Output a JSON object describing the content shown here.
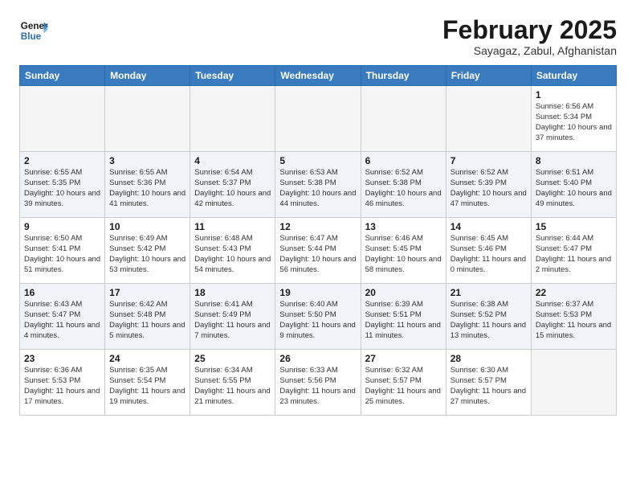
{
  "header": {
    "logo_line1": "General",
    "logo_line2": "Blue",
    "month_title": "February 2025",
    "location": "Sayagaz, Zabul, Afghanistan"
  },
  "weekdays": [
    "Sunday",
    "Monday",
    "Tuesday",
    "Wednesday",
    "Thursday",
    "Friday",
    "Saturday"
  ],
  "weeks": [
    [
      {
        "day": "",
        "info": ""
      },
      {
        "day": "",
        "info": ""
      },
      {
        "day": "",
        "info": ""
      },
      {
        "day": "",
        "info": ""
      },
      {
        "day": "",
        "info": ""
      },
      {
        "day": "",
        "info": ""
      },
      {
        "day": "1",
        "info": "Sunrise: 6:56 AM\nSunset: 5:34 PM\nDaylight: 10 hours and 37 minutes."
      }
    ],
    [
      {
        "day": "2",
        "info": "Sunrise: 6:55 AM\nSunset: 5:35 PM\nDaylight: 10 hours and 39 minutes."
      },
      {
        "day": "3",
        "info": "Sunrise: 6:55 AM\nSunset: 5:36 PM\nDaylight: 10 hours and 41 minutes."
      },
      {
        "day": "4",
        "info": "Sunrise: 6:54 AM\nSunset: 5:37 PM\nDaylight: 10 hours and 42 minutes."
      },
      {
        "day": "5",
        "info": "Sunrise: 6:53 AM\nSunset: 5:38 PM\nDaylight: 10 hours and 44 minutes."
      },
      {
        "day": "6",
        "info": "Sunrise: 6:52 AM\nSunset: 5:38 PM\nDaylight: 10 hours and 46 minutes."
      },
      {
        "day": "7",
        "info": "Sunrise: 6:52 AM\nSunset: 5:39 PM\nDaylight: 10 hours and 47 minutes."
      },
      {
        "day": "8",
        "info": "Sunrise: 6:51 AM\nSunset: 5:40 PM\nDaylight: 10 hours and 49 minutes."
      }
    ],
    [
      {
        "day": "9",
        "info": "Sunrise: 6:50 AM\nSunset: 5:41 PM\nDaylight: 10 hours and 51 minutes."
      },
      {
        "day": "10",
        "info": "Sunrise: 6:49 AM\nSunset: 5:42 PM\nDaylight: 10 hours and 53 minutes."
      },
      {
        "day": "11",
        "info": "Sunrise: 6:48 AM\nSunset: 5:43 PM\nDaylight: 10 hours and 54 minutes."
      },
      {
        "day": "12",
        "info": "Sunrise: 6:47 AM\nSunset: 5:44 PM\nDaylight: 10 hours and 56 minutes."
      },
      {
        "day": "13",
        "info": "Sunrise: 6:46 AM\nSunset: 5:45 PM\nDaylight: 10 hours and 58 minutes."
      },
      {
        "day": "14",
        "info": "Sunrise: 6:45 AM\nSunset: 5:46 PM\nDaylight: 11 hours and 0 minutes."
      },
      {
        "day": "15",
        "info": "Sunrise: 6:44 AM\nSunset: 5:47 PM\nDaylight: 11 hours and 2 minutes."
      }
    ],
    [
      {
        "day": "16",
        "info": "Sunrise: 6:43 AM\nSunset: 5:47 PM\nDaylight: 11 hours and 4 minutes."
      },
      {
        "day": "17",
        "info": "Sunrise: 6:42 AM\nSunset: 5:48 PM\nDaylight: 11 hours and 5 minutes."
      },
      {
        "day": "18",
        "info": "Sunrise: 6:41 AM\nSunset: 5:49 PM\nDaylight: 11 hours and 7 minutes."
      },
      {
        "day": "19",
        "info": "Sunrise: 6:40 AM\nSunset: 5:50 PM\nDaylight: 11 hours and 9 minutes."
      },
      {
        "day": "20",
        "info": "Sunrise: 6:39 AM\nSunset: 5:51 PM\nDaylight: 11 hours and 11 minutes."
      },
      {
        "day": "21",
        "info": "Sunrise: 6:38 AM\nSunset: 5:52 PM\nDaylight: 11 hours and 13 minutes."
      },
      {
        "day": "22",
        "info": "Sunrise: 6:37 AM\nSunset: 5:53 PM\nDaylight: 11 hours and 15 minutes."
      }
    ],
    [
      {
        "day": "23",
        "info": "Sunrise: 6:36 AM\nSunset: 5:53 PM\nDaylight: 11 hours and 17 minutes."
      },
      {
        "day": "24",
        "info": "Sunrise: 6:35 AM\nSunset: 5:54 PM\nDaylight: 11 hours and 19 minutes."
      },
      {
        "day": "25",
        "info": "Sunrise: 6:34 AM\nSunset: 5:55 PM\nDaylight: 11 hours and 21 minutes."
      },
      {
        "day": "26",
        "info": "Sunrise: 6:33 AM\nSunset: 5:56 PM\nDaylight: 11 hours and 23 minutes."
      },
      {
        "day": "27",
        "info": "Sunrise: 6:32 AM\nSunset: 5:57 PM\nDaylight: 11 hours and 25 minutes."
      },
      {
        "day": "28",
        "info": "Sunrise: 6:30 AM\nSunset: 5:57 PM\nDaylight: 11 hours and 27 minutes."
      },
      {
        "day": "",
        "info": ""
      }
    ]
  ]
}
